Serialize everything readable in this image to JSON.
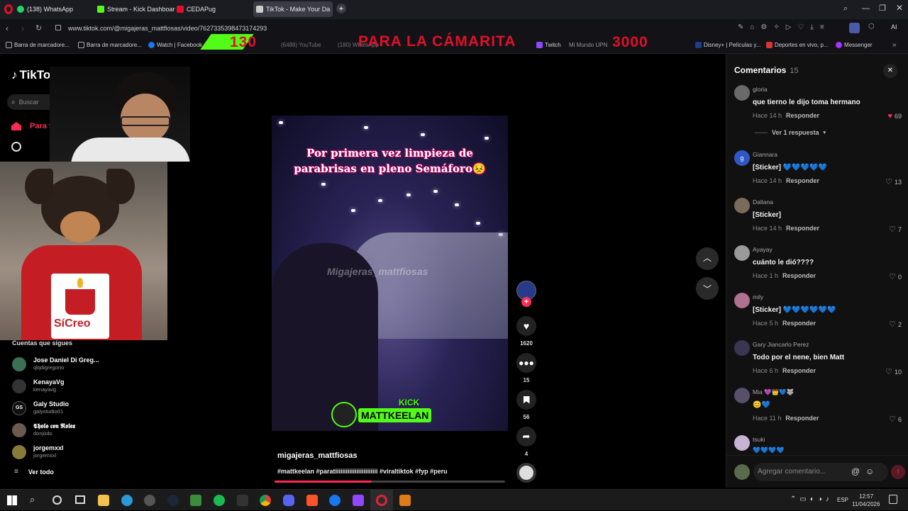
{
  "browser": {
    "tabs": [
      {
        "title": "(138) WhatsApp",
        "color": "#25d366"
      },
      {
        "title": "Stream - Kick Dashboard",
        "color": "#53fc18"
      },
      {
        "title": "CEDAPug",
        "color": "#e0102a"
      },
      {
        "title": "TikTok - Make Your Da",
        "color": "#cccccc"
      }
    ],
    "url": "www.tiktok.com/@migajeras_mattfiosas/video/7627335398473174293",
    "bookmarks": [
      "Barra de marcadore...",
      "Barra de marcadore...",
      "Watch | Facebook",
      "(6489) YouTube",
      "(180) WhatsApp",
      "Twitch",
      "Mi Mundo UPN",
      "Disney+ | Películas y...",
      "Deportes en vivo, p...",
      "Messenger"
    ]
  },
  "stream_overlay": {
    "left_number": "130",
    "title": "PARA LA CÁMARITA",
    "right_number": "3000"
  },
  "tiktok": {
    "logo": "TikTok",
    "search_placeholder": "Buscar",
    "nav_for_you": "Para ti",
    "following_title": "Cuentas que sigues",
    "accounts": [
      {
        "name": "Jose Daniel Di Greg...",
        "handle": "qlqdigregorio"
      },
      {
        "name": "KenayaVg",
        "handle": "kenayavg"
      },
      {
        "name": "Galy Studio",
        "handle": "galystudio01"
      },
      {
        "name": "𝕮𝖍𝖔𝖑𝖔 𝖈𝖔𝖓 𝕽𝖔𝖑𝖊𝖝",
        "handle": "donjodo"
      },
      {
        "name": "jorgemxxl",
        "handle": "jorgemxxl"
      }
    ],
    "see_all": "Ver todo",
    "webcam_shirt_text": "SíCreo"
  },
  "video": {
    "caption_overlay_line1": "Por primera vez limpieza de",
    "caption_overlay_line2": "parabrisas en pleno Semáforo😣",
    "watermark": "Migajeras_mattfiosas",
    "kick_label": "KICK",
    "kick_channel": "MATTKEELAN",
    "author": "migajeras_mattfiosas",
    "hashtags": "#mattkeelan #paratiiiiiiiiiiiiiiiiiiiiiiii #viraltiktok #fyp #peru",
    "likes": "1620",
    "comments": "15",
    "saves": "56",
    "shares": "4"
  },
  "comments_panel": {
    "title": "Comentarios",
    "count": "15",
    "reply_label": "Responder",
    "view_replies": "Ver 1 respuesta",
    "input_placeholder": "Agregar comentario...",
    "items": [
      {
        "user": "gloria",
        "text": "que tierno le dijo toma hermano",
        "time": "Hace 14 h",
        "likes": "69",
        "liked": true
      },
      {
        "user": "Giannara",
        "text": "[Sticker] 💙💙💙💙💙",
        "time": "Hace 14 h",
        "likes": "13",
        "liked": false
      },
      {
        "user": "Dallana",
        "text": "[Sticker]",
        "time": "Hace 14 h",
        "likes": "7",
        "liked": false
      },
      {
        "user": "Ayayay",
        "text": "cuánto le dió????",
        "time": "Hace 1 h",
        "likes": "0",
        "liked": false
      },
      {
        "user": "mily",
        "text": "[Sticker] 💙💙💙💙💙💙",
        "time": "Hace 5 h",
        "likes": "2",
        "liked": false
      },
      {
        "user": "Gary Jiancarlo Perez",
        "text": "Todo por el nene, bien Matt",
        "time": "Hace 6 h",
        "likes": "10",
        "liked": false
      },
      {
        "user": "Mia 💜👑💙🐺",
        "text": "😊💙",
        "time": "Hace 11 h",
        "likes": "6",
        "liked": false
      },
      {
        "user": "tsuki",
        "text": "💙💙💙💙",
        "time": "",
        "likes": "",
        "liked": false
      }
    ]
  },
  "taskbar": {
    "lang": "ESP",
    "time": "12:57",
    "date": "11/04/2026"
  }
}
